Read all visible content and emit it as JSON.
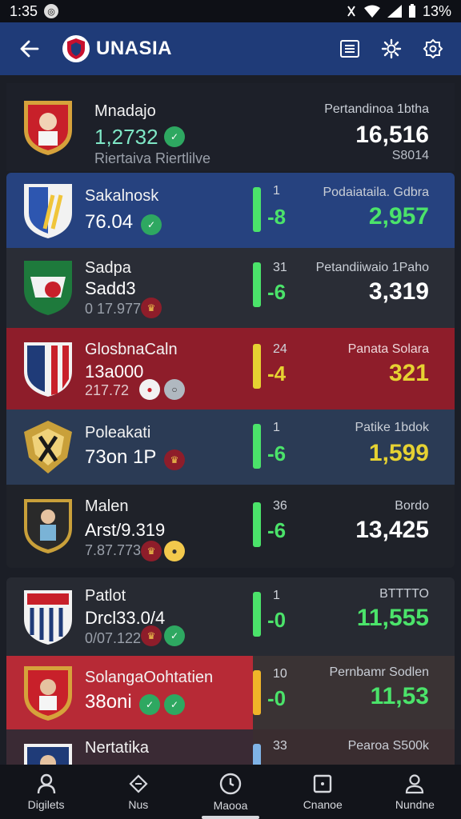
{
  "status": {
    "time": "1:35",
    "battery": "13%"
  },
  "appbar": {
    "title": "UNASIA"
  },
  "colors": {
    "appbar": "#1f3b78",
    "green": "#4be36a",
    "yellow": "#e6d232",
    "red_row": "#8e1d2a",
    "blue_row": "#26427f"
  },
  "rows": [
    {
      "name": "Mnadajo",
      "value": "1,2732",
      "sub": "Riertaiva Riertlilve",
      "rank_top": "",
      "delta": "",
      "right_label": "Pertandinoa 1btha",
      "right_value": "16,516",
      "right_sub": "S8014"
    },
    {
      "name": "Sakalnosk",
      "value": "76.04",
      "sub": "",
      "rank_top": "1",
      "delta": "-8",
      "right_label": "Podaiataila. Gdbra",
      "right_value": "2,957",
      "right_sub": ""
    },
    {
      "name": "Sadpa",
      "value": "Sadd3",
      "sub": "0 17.977",
      "rank_top": "31",
      "delta": "-6",
      "right_label": "Petandiiwaio 1Paho",
      "right_value": "3,319",
      "right_sub": ""
    },
    {
      "name": "GlosbnaCaln",
      "value": "13a000",
      "sub": "217.72",
      "rank_top": "24",
      "delta": "-4",
      "right_label": "Panata Solara",
      "right_value": "321",
      "right_sub": ""
    },
    {
      "name": "Poleakati",
      "value": "73on 1P",
      "sub": "",
      "rank_top": "1",
      "delta": "-6",
      "right_label": "Patike 1bdok",
      "right_value": "1,599",
      "right_sub": ""
    },
    {
      "name": "Malen",
      "value": "Arst/9.319",
      "sub": "7.87.773",
      "rank_top": "36",
      "delta": "-6",
      "right_label": "Bordo",
      "right_value": "13,425",
      "right_sub": ""
    },
    {
      "name": "Patlot",
      "value": "Drcl33.0/4",
      "sub": "0/07.122",
      "rank_top": "1",
      "delta": "-0",
      "right_label": "BTTTTO",
      "right_value": "11,555",
      "right_sub": ""
    },
    {
      "name": "SolangaOohtatien",
      "value": "38oni",
      "sub": "",
      "rank_top": "10",
      "delta": "-0",
      "right_label": "Pernbamr Sodlen",
      "right_value": "11,53",
      "right_sub": ""
    },
    {
      "name": "Nertatika",
      "value": "",
      "sub": "",
      "rank_top": "33",
      "delta": "",
      "right_label": "Pearoa S500k",
      "right_value": "",
      "right_sub": ""
    }
  ],
  "nav": [
    {
      "label": "Digilets",
      "icon": "person-pin-icon"
    },
    {
      "label": "Nus",
      "icon": "news-icon"
    },
    {
      "label": "Maooa",
      "icon": "clock-icon"
    },
    {
      "label": "Cnanoe",
      "icon": "frame-icon"
    },
    {
      "label": "Nundne",
      "icon": "profile-icon"
    }
  ]
}
